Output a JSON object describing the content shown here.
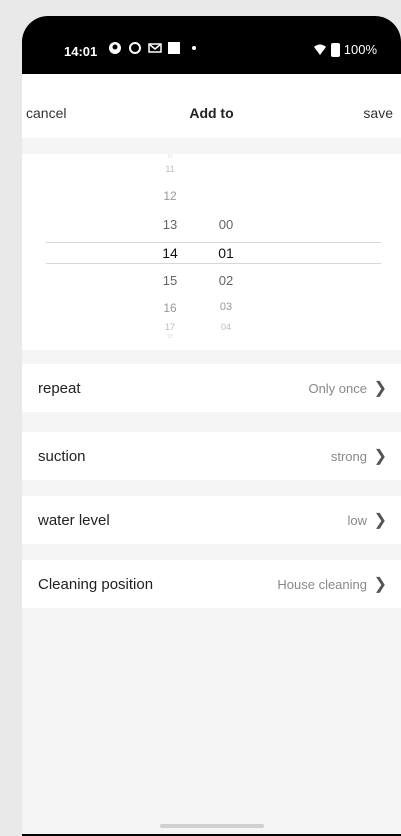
{
  "status": {
    "time": "14:01",
    "battery": "100%"
  },
  "nav": {
    "cancel": "cancel",
    "title": "Add to",
    "save": "save"
  },
  "picker": {
    "hours": [
      "10",
      "11",
      "12",
      "13",
      "14",
      "15",
      "16",
      "17",
      "18"
    ],
    "minutes": [
      "00",
      "01",
      "02",
      "03",
      "04"
    ],
    "selected_hour": "14",
    "selected_minute": "01"
  },
  "settings": [
    {
      "label": "repeat",
      "value": "Only once"
    },
    {
      "label": "suction",
      "value": "strong"
    },
    {
      "label": "water level",
      "value": "low"
    },
    {
      "label": "Cleaning position",
      "value": "House cleaning"
    }
  ],
  "icons": {
    "status_left": [
      "github-icon",
      "circle-icon",
      "mail-icon",
      "square-icon",
      "dot-icon"
    ],
    "status_right": [
      "wifi-icon",
      "battery-icon"
    ]
  }
}
